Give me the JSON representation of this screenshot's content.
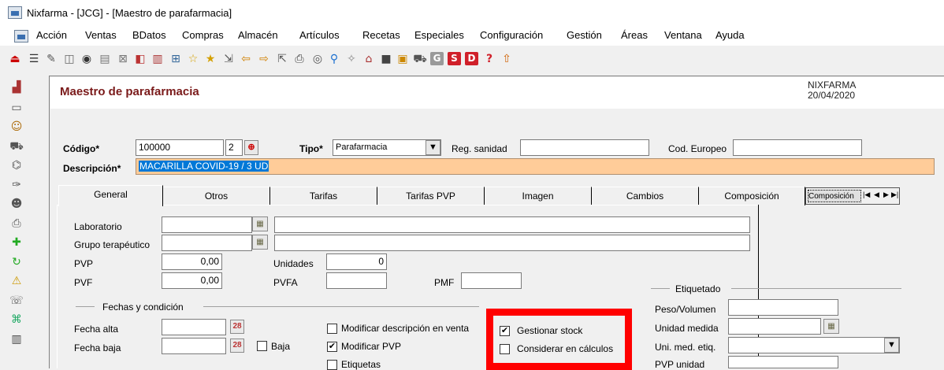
{
  "window": {
    "title": "Nixfarma - [JCG] - [Maestro de parafarmacia]"
  },
  "menu": [
    "Acción",
    "Ventas",
    "BDatos",
    "Compras",
    "Almacén",
    "Artículos",
    "Recetas",
    "Especiales",
    "Configuración",
    "Gestión",
    "Áreas",
    "Ventana",
    "Ayuda"
  ],
  "toolbar": {
    "icons": [
      "exit-icon",
      "list-icon",
      "edit-icon",
      "book-icon",
      "binoculars-icon",
      "form-icon",
      "grid-icon",
      "pill-icon",
      "chart-icon",
      "tree-icon",
      "star-icon",
      "star-filled-icon",
      "export-icon",
      "arrow-left-icon",
      "arrow-right-icon",
      "import-icon",
      "printer-icon",
      "camera-icon",
      "pin-icon",
      "wand-icon",
      "house-icon",
      "square-icon",
      "document-icon",
      "cart-icon",
      "g-icon",
      "s-icon",
      "d-icon",
      "help-icon",
      "upload-icon"
    ],
    "g_label": "G",
    "s_label": "S",
    "d_label": "D",
    "help_label": "?"
  },
  "colors": {
    "page_title": "#7a1a1a",
    "description_bg": "#ffcc99",
    "selection": "#0078d7",
    "highlight": "#ff0000"
  },
  "header": {
    "title": "Maestro de parafarmacia",
    "brand": "NIXFARMA",
    "date": "20/04/2020"
  },
  "form": {
    "codigo_label": "Código*",
    "codigo_value": "100000",
    "codigo_suffix": "2",
    "tipo_label": "Tipo*",
    "tipo_value": "Parafarmacia",
    "reg_sanidad_label": "Reg. sanidad",
    "reg_sanidad_value": "",
    "cod_europeo_label": "Cod. Europeo",
    "cod_europeo_value": "",
    "descripcion_label": "Descripción*",
    "descripcion_value": "MACARILLA COVID-19 / 3 UD"
  },
  "tabs": [
    {
      "label": "General",
      "active": true
    },
    {
      "label": "Otros"
    },
    {
      "label": "Tarifas"
    },
    {
      "label": "Tarifas PVP"
    },
    {
      "label": "Imagen"
    },
    {
      "label": "Cambios"
    },
    {
      "label": "Composición"
    },
    {
      "label": "Composición"
    }
  ],
  "general": {
    "laboratorio_label": "Laboratorio",
    "grupo_label": "Grupo terapéutico",
    "pvp_label": "PVP",
    "pvp_value": "0,00",
    "pvf_label": "PVF",
    "pvf_value": "0,00",
    "unidades_label": "Unidades",
    "unidades_value": "0",
    "pvfa_label": "PVFA",
    "pvfa_value": "",
    "pmf_label": "PMF",
    "pmf_value": "",
    "fechas_section": "Fechas y condición",
    "fecha_alta_label": "Fecha alta",
    "fecha_alta_value": "",
    "fecha_baja_label": "Fecha baja",
    "fecha_baja_value": "",
    "baja_label": "Baja",
    "baja_checked": false,
    "mod_desc_label": "Modificar descripción en venta",
    "mod_desc_checked": false,
    "mod_pvp_label": "Modificar PVP",
    "mod_pvp_checked": true,
    "etiquetas_label": "Etiquetas",
    "etiquetas_checked": false,
    "gestionar_label": "Gestionar stock",
    "gestionar_checked": true,
    "considerar_label": "Considerar en cálculos",
    "considerar_checked": false,
    "etiquetado_section": "Etiquetado",
    "peso_label": "Peso/Volumen",
    "peso_value": "",
    "unidad_medida_label": "Unidad medida",
    "unidad_medida_value": "",
    "uni_med_etiq_label": "Uni. med. etiq.",
    "uni_med_etiq_value": "",
    "pvp_unidad_label": "PVP unidad"
  },
  "check_mark": "✔",
  "calendar_glyph": "28"
}
